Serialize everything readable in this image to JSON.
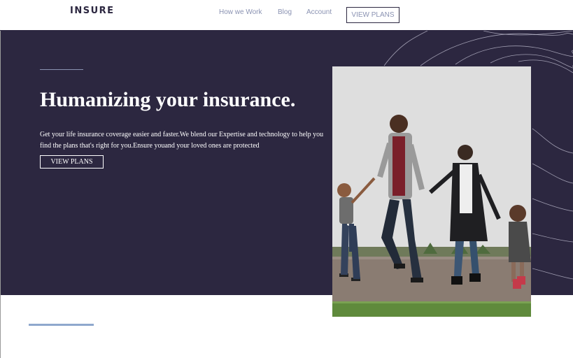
{
  "header": {
    "logo": "INSURE",
    "nav": [
      {
        "label": "How we Work"
      },
      {
        "label": "Blog"
      },
      {
        "label": "Account"
      }
    ],
    "cta_label": "VIEW PLANS"
  },
  "hero": {
    "title": "Humanizing your insurance.",
    "description": "Get your life insurance coverage easier and faster.We blend our Expertise and technology to help you find the plans that's right for you.Ensure youand your loved ones are protected",
    "cta_label": "VIEW PLANS",
    "image_alt": "family-walking-photo"
  },
  "colors": {
    "primary_dark": "#2c2740",
    "nav_text": "#8a92b2",
    "accent_line": "#8fa8cd",
    "background": "#ffffff"
  }
}
